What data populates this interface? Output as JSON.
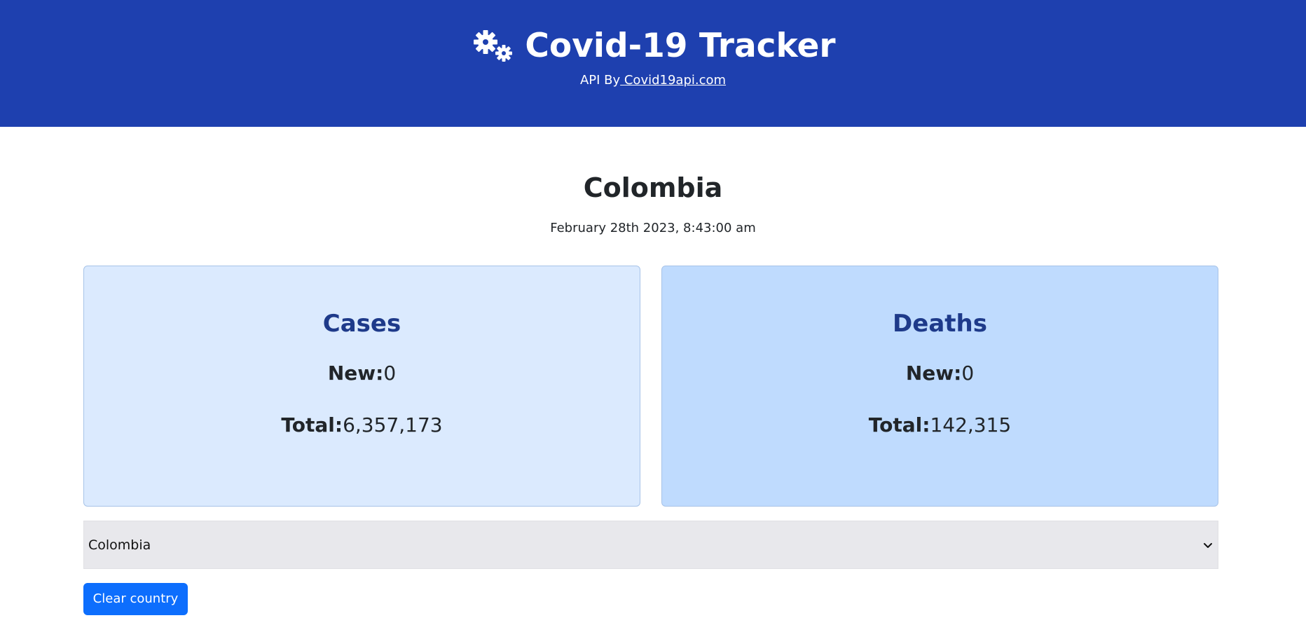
{
  "header": {
    "title": "Covid-19 Tracker",
    "icon": "gears-icon",
    "subtitle_prefix": "API By",
    "subtitle_link": " Covid19api.com",
    "background_color": "#1e40af"
  },
  "main": {
    "country": "Colombia",
    "timestamp": "February 28th 2023, 8:43:00 am"
  },
  "cards": [
    {
      "title": "Cases",
      "new_label": "New:",
      "new_value": "0",
      "total_label": "Total:",
      "total_value": "6,357,173",
      "background_color": "#dbeafe"
    },
    {
      "title": "Deaths",
      "new_label": "New:",
      "new_value": "0",
      "total_label": "Total:",
      "total_value": "142,315",
      "background_color": "#bfdbfe"
    }
  ],
  "country_select": {
    "selected": "Colombia"
  },
  "clear_button": {
    "label": "Clear country",
    "color": "#0d6efd"
  }
}
